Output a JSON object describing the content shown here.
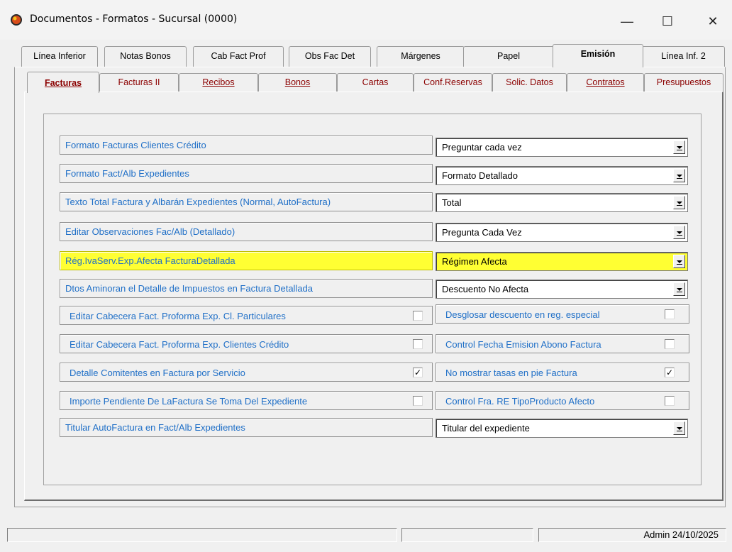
{
  "window": {
    "title": "Documentos - Formatos - Sucursal (0000)",
    "minimize": "—",
    "maximize": "☐",
    "close": "✕"
  },
  "outer_tabs": [
    {
      "label": "Línea Inferior",
      "active": false
    },
    {
      "label": "Notas Bonos",
      "active": false
    },
    {
      "label": "Cab Fact Prof",
      "active": false
    },
    {
      "label": "Obs Fac Det",
      "active": false
    },
    {
      "label": "Márgenes",
      "active": false
    },
    {
      "label": "Papel",
      "active": false
    },
    {
      "label": "Emisión",
      "active": true
    },
    {
      "label": "Línea Inf. 2",
      "active": false
    }
  ],
  "inner_tabs": [
    {
      "label": "Facturas",
      "active": true
    },
    {
      "label": "Facturas II",
      "active": false
    },
    {
      "label": "Recibos",
      "active": false
    },
    {
      "label": "Bonos",
      "active": false
    },
    {
      "label": "Cartas",
      "active": false
    },
    {
      "label": "Conf.Reservas",
      "active": false
    },
    {
      "label": "Solic. Datos",
      "active": false
    },
    {
      "label": "Contratos",
      "active": false
    },
    {
      "label": "Presupuestos",
      "active": false
    }
  ],
  "rows": [
    {
      "label": "Formato Facturas Clientes Crédito",
      "value": "Preguntar cada vez"
    },
    {
      "label": "Formato Fact/Alb Expedientes",
      "value": "Formato Detallado"
    },
    {
      "label": "Texto Total Factura y Albarán Expedientes (Normal, AutoFactura)",
      "value": "Total"
    },
    {
      "label": "Editar Observaciones Fac/Alb (Detallado)",
      "value": "Pregunta Cada Vez"
    },
    {
      "label": "Rég.IvaServ.Exp.Afecta FacturaDetallada",
      "value": "Régimen Afecta"
    },
    {
      "label": "Dtos Aminoran el Detalle de Impuestos en Factura Detallada",
      "value": "Descuento No Afecta"
    }
  ],
  "checks": [
    {
      "left_label": "Editar Cabecera Fact. Proforma Exp. Cl. Particulares",
      "left_checked": "",
      "right_label": "Desglosar descuento en reg. especial",
      "right_checked": ""
    },
    {
      "left_label": "Editar Cabecera Fact. Proforma Exp. Clientes Crédito",
      "left_checked": "",
      "right_label": "Control Fecha Emision Abono Factura",
      "right_checked": ""
    },
    {
      "left_label": "Detalle Comitentes en Factura por Servicio",
      "left_checked": "✓",
      "right_label": "No mostrar tasas en pie Factura",
      "right_checked": "✓"
    },
    {
      "left_label": "Importe Pendiente De LaFactura Se Toma Del Expediente",
      "left_checked": "",
      "right_label": "Control Fra. RE TipoProducto Afecto",
      "right_checked": ""
    }
  ],
  "last_row": {
    "label": "Titular AutoFactura  en Fact/Alb Expedientes",
    "value": "Titular del expediente"
  },
  "statusbar": {
    "user_date": "Admin 24/10/2025"
  },
  "colors": {
    "label_text": "#1f6fc7",
    "highlight": "#ffff33",
    "tab_text": "#8b0000"
  }
}
